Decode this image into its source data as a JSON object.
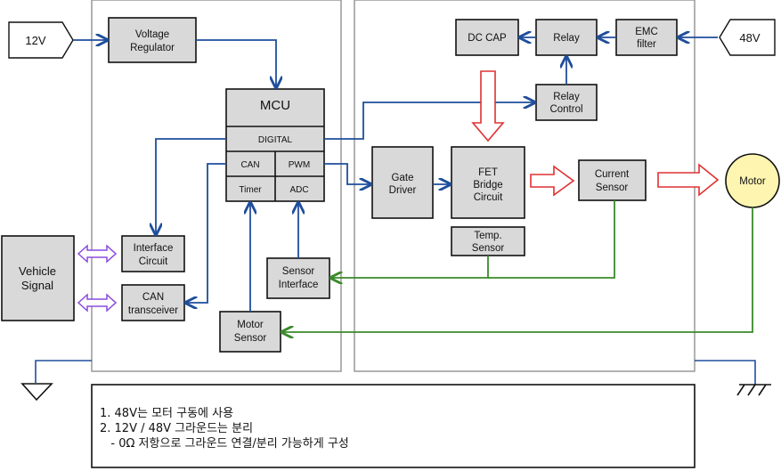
{
  "colors": {
    "signal": "#1f4e9c",
    "feedback": "#3a8a2a",
    "power": "#e03030",
    "bus": "#8a4be0",
    "box": "#d9d9d9"
  },
  "inputs": {
    "v12": "12V",
    "v48": "48V"
  },
  "blocks": {
    "voltage_regulator": [
      "Voltage",
      "Regulator"
    ],
    "mcu": "MCU",
    "digital": "DIGITAL",
    "can": "CAN",
    "pwm": "PWM",
    "timer": "Timer",
    "adc": "ADC",
    "dc_cap": "DC CAP",
    "relay": "Relay",
    "emc_filter": [
      "EMC",
      "filter"
    ],
    "relay_control": [
      "Relay",
      "Control"
    ],
    "gate_driver": [
      "Gate",
      "Driver"
    ],
    "fet_bridge": [
      "FET",
      "Bridge",
      "Circuit"
    ],
    "temp_sensor": [
      "Temp.",
      "Sensor"
    ],
    "current_sensor": [
      "Current",
      "Sensor"
    ],
    "motor": "Motor",
    "vehicle_signal": [
      "Vehicle",
      "Signal"
    ],
    "interface_circuit": [
      "Interface",
      "Circuit"
    ],
    "can_transceiver": [
      "CAN",
      "transceiver"
    ],
    "sensor_interface": [
      "Sensor",
      "Interface"
    ],
    "motor_sensor": [
      "Motor",
      "Sensor"
    ]
  },
  "notes": [
    "1. 48V는 모터 구동에 사용",
    "2. 12V / 48V 그라운드는 분리",
    "   - 0Ω 저항으로 그라운드 연결/분리 가능하게 구성"
  ]
}
